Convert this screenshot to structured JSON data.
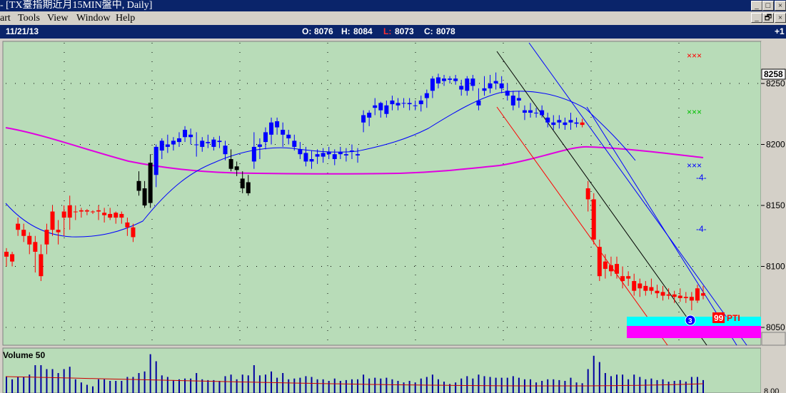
{
  "window": {
    "title": "- [TX臺指期近月15MIN盤中, Daily]",
    "minimize_glyph": "_",
    "maximize_glyph": "□",
    "close_glyph": "×",
    "restore_glyph": "🗗"
  },
  "menu": {
    "items": [
      "art",
      "Tools",
      "View",
      "Window",
      "Help"
    ]
  },
  "info": {
    "date": "11/21/13",
    "open_label": "O:",
    "open_value": "8076",
    "high_label": "H:",
    "high_value": "8084",
    "low_label": "L:",
    "low_value": "8073",
    "close_label": "C:",
    "close_value": "8078",
    "right_value": "+1"
  },
  "price_axis": {
    "ticks": [
      "8250",
      "8200",
      "8150",
      "8100",
      "8050"
    ],
    "current_price": "8258"
  },
  "annotations": {
    "marker_4a": "-4-",
    "marker_4b": "-4-",
    "circle_label": "3",
    "badge_99": "99",
    "pti_label": "PTI"
  },
  "volume_panel": {
    "title": "Volume 50",
    "axis_label": "8.00"
  },
  "colors": {
    "background": "#b8dcb8",
    "bull": "#ff0000",
    "bear": "#0000ff",
    "flat": "#000000",
    "ma_magenta": "#e000e0",
    "ma_blue": "#0000ff",
    "cyan_band": "#00ffff",
    "magenta_band": "#ff00ff",
    "title_bar": "#0a246a"
  },
  "chart_data": {
    "type": "candlestick",
    "ylim": [
      8025,
      8270
    ],
    "y_ticks": [
      8250,
      8200,
      8150,
      8100,
      8050
    ],
    "series": [
      {
        "name": "Price",
        "ohlc": [
          [
            8108,
            8115,
            8100,
            8112
          ],
          [
            8110,
            8112,
            8100,
            8104
          ],
          [
            8135,
            8140,
            8125,
            8130
          ],
          [
            8130,
            8135,
            8120,
            8125
          ],
          [
            8125,
            8128,
            8110,
            8118
          ],
          [
            8120,
            8125,
            8095,
            8112
          ],
          [
            8110,
            8118,
            8088,
            8092
          ],
          [
            8118,
            8135,
            8110,
            8130
          ],
          [
            8130,
            8150,
            8125,
            8145
          ],
          [
            8128,
            8138,
            8118,
            8130
          ],
          [
            8140,
            8150,
            8125,
            8145
          ],
          [
            8140,
            8158,
            8130,
            8150
          ],
          [
            8145,
            8150,
            8138,
            8145
          ],
          [
            8145,
            8148,
            8140,
            8146
          ],
          [
            8145,
            8147,
            8142,
            8146
          ],
          [
            8145,
            8146,
            8143,
            8145
          ],
          [
            8145,
            8150,
            8138,
            8146
          ],
          [
            8142,
            8148,
            8136,
            8144
          ],
          [
            8143,
            8148,
            8138,
            8140
          ],
          [
            8140,
            8145,
            8135,
            8144
          ],
          [
            8143,
            8145,
            8135,
            8140
          ],
          [
            8132,
            8140,
            8125,
            8136
          ],
          [
            8132,
            8135,
            8120,
            8124
          ],
          [
            8170,
            8178,
            8158,
            8162
          ],
          [
            8164,
            8170,
            8148,
            8150
          ],
          [
            8185,
            8192,
            8148,
            8152
          ],
          [
            8175,
            8200,
            8165,
            8198
          ],
          [
            8195,
            8205,
            8188,
            8203
          ],
          [
            8198,
            8208,
            8193,
            8200
          ],
          [
            8200,
            8206,
            8195,
            8203
          ],
          [
            8202,
            8210,
            8198,
            8205
          ],
          [
            8206,
            8215,
            8202,
            8212
          ],
          [
            8208,
            8213,
            8200,
            8206
          ],
          [
            8200,
            8210,
            8190,
            8200
          ],
          [
            8198,
            8206,
            8194,
            8203
          ],
          [
            8202,
            8208,
            8197,
            8201
          ],
          [
            8198,
            8206,
            8195,
            8204
          ],
          [
            8202,
            8207,
            8197,
            8203
          ],
          [
            8192,
            8203,
            8187,
            8199
          ],
          [
            8188,
            8196,
            8178,
            8180
          ],
          [
            8182,
            8186,
            8174,
            8179
          ],
          [
            8172,
            8178,
            8160,
            8164
          ],
          [
            8169,
            8175,
            8158,
            8160
          ],
          [
            8186,
            8210,
            8180,
            8198
          ],
          [
            8198,
            8205,
            8188,
            8200
          ],
          [
            8202,
            8214,
            8196,
            8210
          ],
          [
            8208,
            8222,
            8200,
            8218
          ],
          [
            8219,
            8222,
            8208,
            8214
          ],
          [
            8212,
            8218,
            8198,
            8208
          ],
          [
            8208,
            8212,
            8200,
            8205
          ],
          [
            8203,
            8208,
            8195,
            8198
          ],
          [
            8196,
            8202,
            8188,
            8192
          ],
          [
            8193,
            8198,
            8182,
            8186
          ],
          [
            8188,
            8195,
            8180,
            8186
          ],
          [
            8190,
            8196,
            8184,
            8192
          ],
          [
            8190,
            8197,
            8185,
            8193
          ],
          [
            8192,
            8198,
            8188,
            8194
          ],
          [
            8192,
            8196,
            8183,
            8188
          ],
          [
            8194,
            8198,
            8188,
            8192
          ],
          [
            8192,
            8197,
            8186,
            8191
          ],
          [
            8194,
            8200,
            8188,
            8195
          ],
          [
            8192,
            8197,
            8185,
            8191
          ],
          [
            8218,
            8228,
            8210,
            8224
          ],
          [
            8222,
            8228,
            8215,
            8226
          ],
          [
            8230,
            8238,
            8224,
            8232
          ],
          [
            8228,
            8235,
            8222,
            8234
          ],
          [
            8225,
            8236,
            8222,
            8232
          ],
          [
            8233,
            8240,
            8228,
            8236
          ],
          [
            8232,
            8238,
            8228,
            8234
          ],
          [
            8234,
            8238,
            8230,
            8234
          ],
          [
            8233,
            8238,
            8228,
            8234
          ],
          [
            8232,
            8236,
            8228,
            8232
          ],
          [
            8233,
            8240,
            8227,
            8236
          ],
          [
            8238,
            8245,
            8230,
            8242
          ],
          [
            8244,
            8256,
            8238,
            8254
          ],
          [
            8255,
            8258,
            8246,
            8250
          ],
          [
            8252,
            8257,
            8248,
            8254
          ],
          [
            8253,
            8256,
            8250,
            8254
          ],
          [
            8254,
            8257,
            8249,
            8252
          ],
          [
            8245,
            8253,
            8240,
            8248
          ],
          [
            8244,
            8256,
            8240,
            8254
          ],
          [
            8248,
            8257,
            8244,
            8254
          ],
          [
            8236,
            8246,
            8228,
            8232
          ],
          [
            8244,
            8256,
            8240,
            8246
          ],
          [
            8246,
            8257,
            8242,
            8250
          ],
          [
            8250,
            8259,
            8245,
            8252
          ],
          [
            8250,
            8256,
            8242,
            8246
          ],
          [
            8244,
            8250,
            8236,
            8240
          ],
          [
            8240,
            8244,
            8228,
            8232
          ],
          [
            8238,
            8244,
            8230,
            8236
          ],
          [
            8226,
            8232,
            8220,
            8228
          ],
          [
            8228,
            8234,
            8222,
            8226
          ],
          [
            8226,
            8230,
            8222,
            8226
          ],
          [
            8228,
            8232,
            8222,
            8224
          ],
          [
            8222,
            8226,
            8214,
            8218
          ],
          [
            8218,
            8224,
            8212,
            8216
          ],
          [
            8218,
            8224,
            8213,
            8220
          ],
          [
            8216,
            8222,
            8212,
            8218
          ],
          [
            8220,
            8226,
            8212,
            8218
          ],
          [
            8217,
            8222,
            8214,
            8218
          ],
          [
            8218,
            8221,
            8214,
            8216
          ],
          [
            8164,
            8170,
            8145,
            8155
          ],
          [
            8155,
            8160,
            8118,
            8122
          ],
          [
            8116,
            8122,
            8088,
            8092
          ],
          [
            8104,
            8110,
            8090,
            8098
          ],
          [
            8101,
            8108,
            8092,
            8096
          ],
          [
            8102,
            8108,
            8090,
            8094
          ],
          [
            8092,
            8100,
            8082,
            8088
          ],
          [
            8090,
            8096,
            8084,
            8092
          ],
          [
            8088,
            8094,
            8076,
            8080
          ],
          [
            8082,
            8090,
            8075,
            8086
          ],
          [
            8080,
            8088,
            8076,
            8084
          ],
          [
            8083,
            8090,
            8077,
            8080
          ],
          [
            8078,
            8085,
            8074,
            8080
          ],
          [
            8079,
            8084,
            8072,
            8076
          ],
          [
            8077,
            8082,
            8073,
            8076
          ],
          [
            8075,
            8080,
            8070,
            8077
          ],
          [
            8076,
            8082,
            8071,
            8074
          ],
          [
            8074,
            8079,
            8070,
            8075
          ],
          [
            8075,
            8079,
            8064,
            8072
          ],
          [
            8072,
            8085,
            8070,
            8082
          ],
          [
            8076,
            8084,
            8073,
            8078
          ]
        ]
      }
    ]
  }
}
